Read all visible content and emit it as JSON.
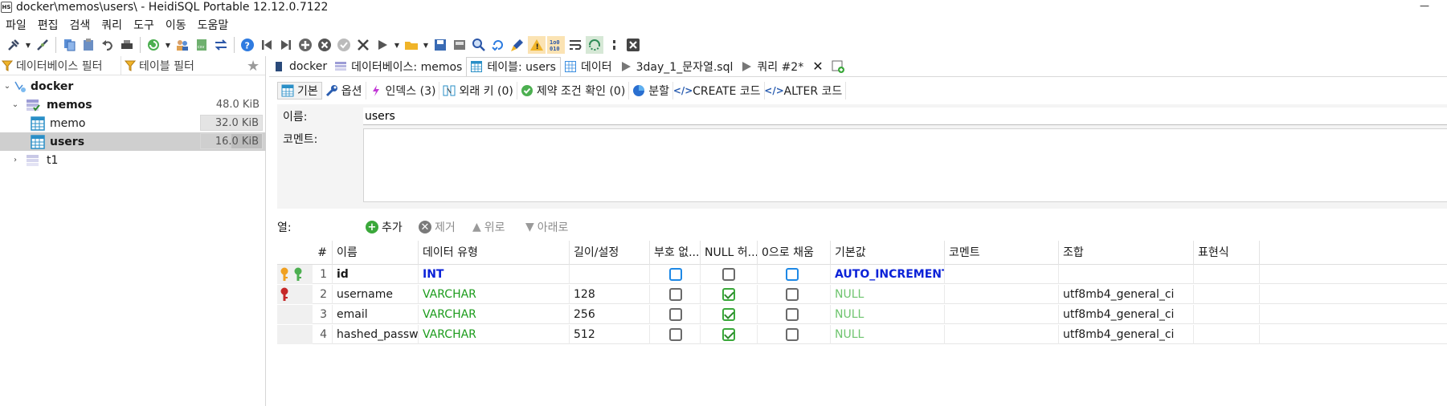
{
  "window": {
    "title": "docker\\memos\\users\\ - HeidiSQL Portable 12.12.0.7122",
    "app_icon_text": "HS"
  },
  "menu": [
    "파일",
    "편집",
    "검색",
    "쿼리",
    "도구",
    "이동",
    "도움말"
  ],
  "left_panel": {
    "db_filter_placeholder": "데이터베이스 필터",
    "table_filter_placeholder": "테이블 필터",
    "tree": [
      {
        "label": "docker",
        "size": "",
        "level": 0,
        "expanded": true
      },
      {
        "label": "memos",
        "size": "48.0 KiB",
        "level": 1,
        "expanded": true,
        "bold": true
      },
      {
        "label": "memo",
        "size": "32.0 KiB",
        "level": 2
      },
      {
        "label": "users",
        "size": "16.0 KiB",
        "level": 2,
        "selected": true
      },
      {
        "label": "t1",
        "size": "",
        "level": 1,
        "expanded": false
      }
    ]
  },
  "main_tabs": [
    {
      "label": "docker",
      "icon": "server-icon"
    },
    {
      "label": "데이터베이스: memos",
      "icon": "database-icon"
    },
    {
      "label": "테이블: users",
      "icon": "table-icon",
      "active": true
    },
    {
      "label": "데이터",
      "icon": "grid-icon"
    },
    {
      "label": "3day_1_문자열.sql",
      "icon": "play-icon"
    },
    {
      "label": "쿼리 #2*",
      "icon": "play-icon"
    }
  ],
  "sub_tabs": [
    {
      "label": "기본",
      "icon": "table-icon",
      "active": true
    },
    {
      "label": "옵션",
      "icon": "wrench-icon"
    },
    {
      "label": "인덱스 (3)",
      "icon": "lightning-icon"
    },
    {
      "label": "외래 키 (0)",
      "icon": "foreign-key-icon"
    },
    {
      "label": "제약 조건 확인 (0)",
      "icon": "check-icon"
    },
    {
      "label": "분할",
      "icon": "pie-icon"
    },
    {
      "label": "CREATE 코드",
      "icon": "code-icon"
    },
    {
      "label": "ALTER 코드",
      "icon": "code-icon"
    }
  ],
  "form": {
    "name_label": "이름:",
    "name_value": "users",
    "comment_label": "코멘트:",
    "comment_value": ""
  },
  "columns_bar": {
    "label": "열:",
    "add": "추가",
    "remove": "제거",
    "up": "위로",
    "down": "아래로"
  },
  "grid": {
    "headers": [
      "#",
      "이름",
      "데이터 유형",
      "길이/설정",
      "부호 없...",
      "NULL 허...",
      "0으로 채움",
      "기본값",
      "코멘트",
      "조합",
      "표현식"
    ],
    "rows": [
      {
        "num": "1",
        "name": "id",
        "type": "INT",
        "length": "",
        "unsigned": false,
        "nullable": false,
        "zerofill": false,
        "default": "AUTO_INCREMENT",
        "comment": "",
        "collation": "",
        "expression": "",
        "keys": [
          "primary-key-icon",
          "unique-key-icon"
        ]
      },
      {
        "num": "2",
        "name": "username",
        "type": "VARCHAR",
        "length": "128",
        "unsigned": false,
        "nullable": true,
        "zerofill": false,
        "default": "NULL",
        "comment": "",
        "collation": "utf8mb4_general_ci",
        "expression": "",
        "keys": [
          "index-key-icon"
        ]
      },
      {
        "num": "3",
        "name": "email",
        "type": "VARCHAR",
        "length": "256",
        "unsigned": false,
        "nullable": true,
        "zerofill": false,
        "default": "NULL",
        "comment": "",
        "collation": "utf8mb4_general_ci",
        "expression": "",
        "keys": []
      },
      {
        "num": "4",
        "name": "hashed_passw...",
        "type": "VARCHAR",
        "length": "512",
        "unsigned": false,
        "nullable": true,
        "zerofill": false,
        "default": "NULL",
        "comment": "",
        "collation": "utf8mb4_general_ci",
        "expression": "",
        "keys": []
      }
    ]
  },
  "colors": {
    "type_int": "#0b22d8",
    "type_varchar": "#1c9c1c",
    "default_null": "#6ec46e",
    "selection": "#cfcfcf"
  }
}
